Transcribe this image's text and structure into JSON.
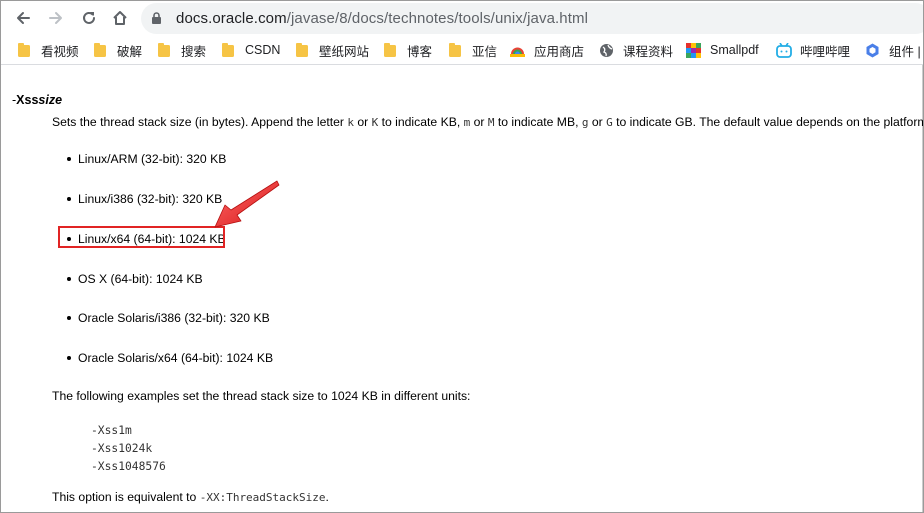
{
  "browser": {
    "url_host": "docs.oracle.com",
    "url_path": "/javase/8/docs/technotes/tools/unix/java.html"
  },
  "bookmarks": [
    {
      "label": "看视频",
      "icon": "folder-icon"
    },
    {
      "label": "破解",
      "icon": "folder-icon"
    },
    {
      "label": "搜索",
      "icon": "folder-icon"
    },
    {
      "label": "CSDN",
      "icon": "folder-icon"
    },
    {
      "label": "壁纸网站",
      "icon": "folder-icon"
    },
    {
      "label": "博客",
      "icon": "folder-icon"
    },
    {
      "label": "亚信",
      "icon": "folder-icon"
    },
    {
      "label": "应用商店",
      "icon": "app-store-icon"
    },
    {
      "label": "课程资料",
      "icon": "globe-icon"
    },
    {
      "label": "Smallpdf",
      "icon": "smallpdf-icon"
    },
    {
      "label": "哔哩哔哩",
      "icon": "bilibili-icon"
    },
    {
      "label": "组件 |",
      "icon": "component-icon"
    }
  ],
  "doc": {
    "option_dash": "-",
    "option_name": "Xss",
    "option_arg": "size",
    "desc_1": "Sets the thread stack size (in bytes). Append the letter ",
    "code_k": "k",
    "desc_or1": " or ",
    "code_K": "K",
    "desc_2": " to indicate KB, ",
    "code_m": "m",
    "desc_or2": " or ",
    "code_M": "M",
    "desc_3": " to indicate MB, ",
    "code_g": "g",
    "desc_or3": " or ",
    "code_G": "G",
    "desc_4": " to indicate GB. The default value depends on the platform:",
    "platforms": [
      "Linux/ARM (32-bit): 320 KB",
      "Linux/i386 (32-bit): 320 KB",
      "Linux/x64 (64-bit): 1024 KB",
      "OS X (64-bit): 1024 KB",
      "Oracle Solaris/i386 (32-bit): 320 KB",
      "Oracle Solaris/x64 (64-bit): 1024 KB"
    ],
    "examples_intro": "The following examples set the thread stack size to 1024 KB in different units:",
    "examples": [
      "-Xss1m",
      "-Xss1024k",
      "-Xss1048576"
    ],
    "equiv_text": "This option is equivalent to ",
    "equiv_code": "-XX:ThreadStackSize",
    "equiv_end": "."
  },
  "colors": {
    "annotation_red": "#e12424",
    "folder_yellow": "#f6c445"
  }
}
